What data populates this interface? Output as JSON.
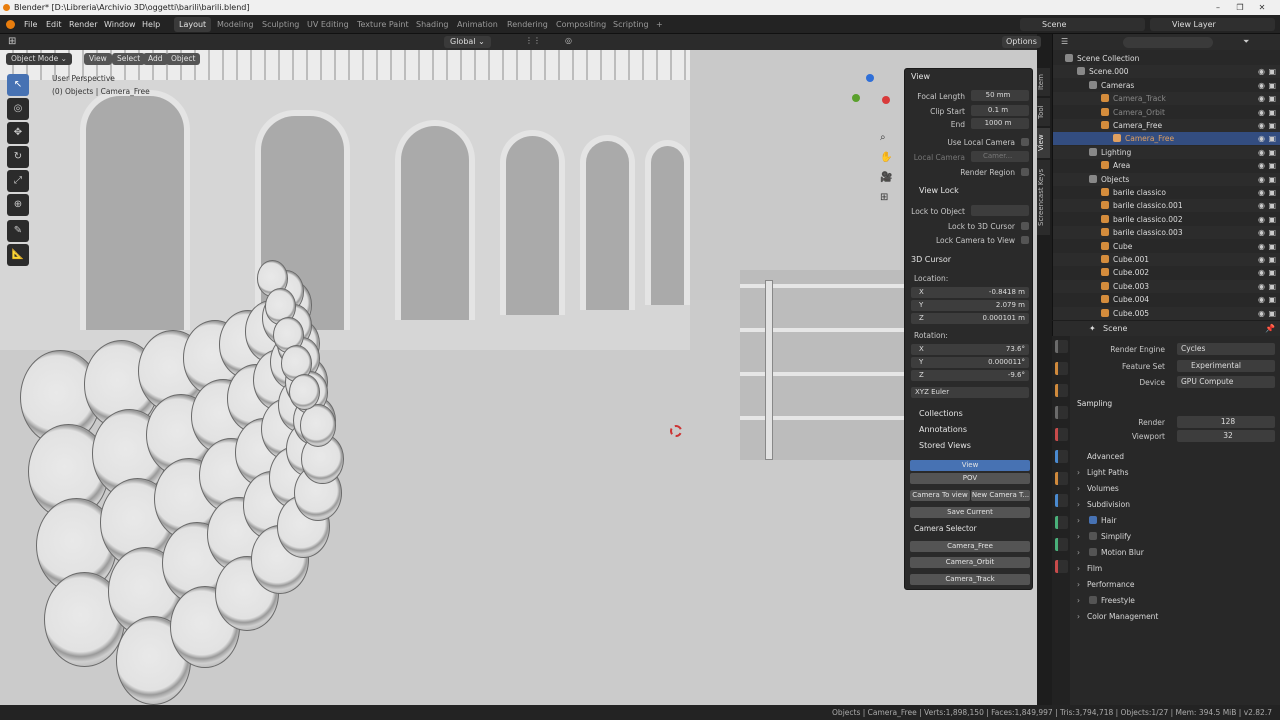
{
  "window": {
    "title": "Blender* [D:\\Libreria\\Archivio 3D\\oggetti\\barili\\barili.blend]"
  },
  "menu": [
    "File",
    "Edit",
    "Render",
    "Window",
    "Help"
  ],
  "workspaces": [
    "Layout",
    "Modeling",
    "Sculpting",
    "UV Editing",
    "Texture Paint",
    "Shading",
    "Animation",
    "Rendering",
    "Compositing",
    "Scripting"
  ],
  "topbar": {
    "scene": "Scene",
    "view_layer": "View Layer"
  },
  "viewport_header": {
    "orientation": "Global",
    "options": "Options",
    "mode": "Object Mode",
    "menus": [
      "View",
      "Select",
      "Add",
      "Object"
    ]
  },
  "viewport_overlay": {
    "line1": "User Perspective",
    "line2": "(0) Objects | Camera_Free"
  },
  "npanel": {
    "view_header": "View",
    "focal_label": "Focal Length",
    "focal": "50 mm",
    "clip_start_label": "Clip Start",
    "clip_start": "0.1 m",
    "end_label": "End",
    "end": "1000 m",
    "use_local_camera": "Use Local Camera",
    "local_camera_label": "Local Camera",
    "local_camera": "Camer...",
    "render_region": "Render Region",
    "view_lock": "View Lock",
    "lock_to_object": "Lock to Object",
    "lock_3d_cursor": "Lock to 3D Cursor",
    "lock_camera": "Lock Camera to View",
    "cursor_header": "3D Cursor",
    "location": "Location:",
    "loc": [
      {
        "axis": "X",
        "val": "-0.8418 m"
      },
      {
        "axis": "Y",
        "val": "2.079 m"
      },
      {
        "axis": "Z",
        "val": "0.000101 m"
      }
    ],
    "rotation": "Rotation:",
    "rot": [
      {
        "axis": "X",
        "val": "73.6°"
      },
      {
        "axis": "Y",
        "val": "0.000011°"
      },
      {
        "axis": "Z",
        "val": "-9.6°"
      }
    ],
    "euler": "XYZ Euler",
    "collections": "Collections",
    "annotations": "Annotations",
    "stored_views": "Stored Views",
    "sv_view": "View",
    "sv_pov": "POV",
    "cam_to_view": "Camera To view",
    "new_cam": "New Camera T...",
    "save_current": "Save Current",
    "camera_selector": "Camera Selector",
    "cameras": [
      "Camera_Free",
      "Camera_Orbit",
      "Camera_Track"
    ]
  },
  "sidetabs": [
    "Item",
    "Tool",
    "View",
    "Screencast Keys"
  ],
  "outliner": {
    "rows": [
      {
        "indent": 0,
        "label": "Scene Collection",
        "color": "#ddd"
      },
      {
        "indent": 1,
        "label": "Scene.000",
        "color": "#ddd"
      },
      {
        "indent": 2,
        "label": "Cameras",
        "color": "#ddd"
      },
      {
        "indent": 3,
        "label": "Camera_Track",
        "color": "#888"
      },
      {
        "indent": 3,
        "label": "Camera_Orbit",
        "color": "#888"
      },
      {
        "indent": 3,
        "label": "Camera_Free",
        "color": "#ddd"
      },
      {
        "indent": 4,
        "label": "Camera_Free",
        "color": "#e0a060"
      },
      {
        "indent": 2,
        "label": "Lighting",
        "color": "#ddd"
      },
      {
        "indent": 3,
        "label": "Area",
        "color": "#ddd"
      },
      {
        "indent": 2,
        "label": "Objects",
        "color": "#ddd"
      },
      {
        "indent": 3,
        "label": "barile classico",
        "color": "#ddd"
      },
      {
        "indent": 3,
        "label": "barile classico.001",
        "color": "#ddd"
      },
      {
        "indent": 3,
        "label": "barile classico.002",
        "color": "#ddd"
      },
      {
        "indent": 3,
        "label": "barile classico.003",
        "color": "#ddd"
      },
      {
        "indent": 3,
        "label": "Cube",
        "color": "#ddd"
      },
      {
        "indent": 3,
        "label": "Cube.001",
        "color": "#ddd"
      },
      {
        "indent": 3,
        "label": "Cube.002",
        "color": "#ddd"
      },
      {
        "indent": 3,
        "label": "Cube.003",
        "color": "#ddd"
      },
      {
        "indent": 3,
        "label": "Cube.004",
        "color": "#ddd"
      },
      {
        "indent": 3,
        "label": "Cube.005",
        "color": "#ddd"
      }
    ]
  },
  "properties": {
    "scene": "Scene",
    "render_engine_label": "Render Engine",
    "render_engine": "Cycles",
    "feature_set_label": "Feature Set",
    "feature_set": "Experimental",
    "device_label": "Device",
    "device": "GPU Compute",
    "sampling": "Sampling",
    "render_label": "Render",
    "render": "128",
    "viewport_label": "Viewport",
    "viewport": "32",
    "advanced": "Advanced",
    "sections": [
      "Light Paths",
      "Volumes",
      "Subdivision",
      "Hair",
      "Simplify",
      "Motion Blur",
      "Film",
      "Performance",
      "Freestyle",
      "Color Management"
    ]
  },
  "status": "Objects | Camera_Free | Verts:1,898,150 | Faces:1,849,997 | Tris:3,794,718 | Objects:1/27 | Mem: 394.5 MiB | v2.82.7",
  "colors": {
    "accent": "#4772b3",
    "selected_row": "#334d80"
  }
}
